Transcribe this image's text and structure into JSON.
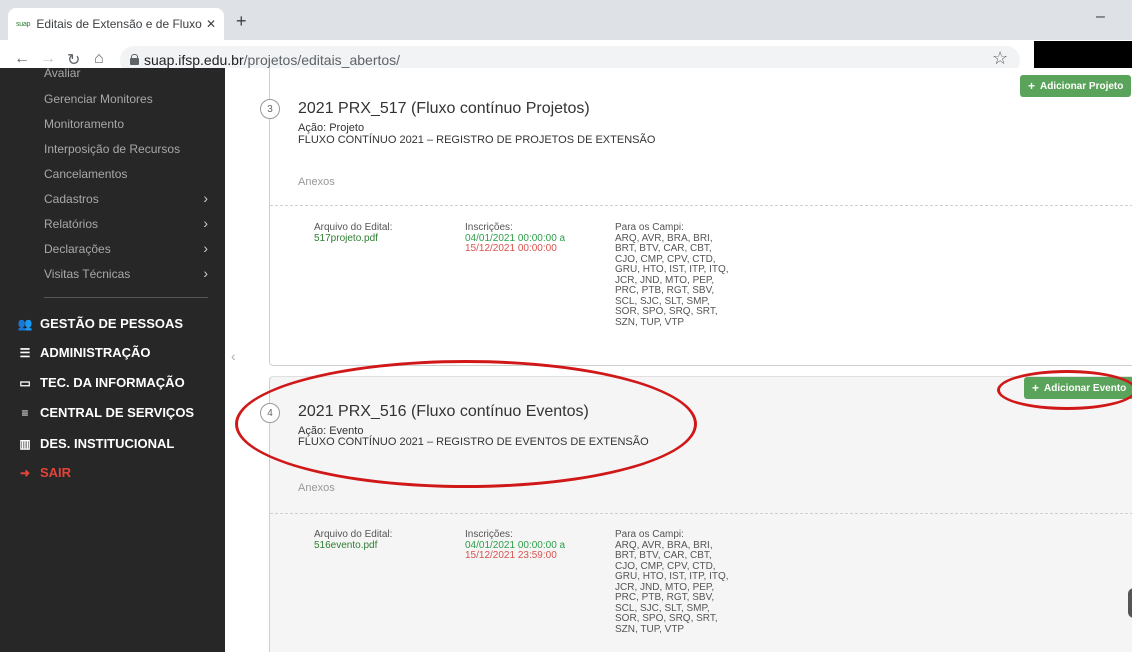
{
  "browser": {
    "tab_favicon": "suap",
    "tab_title": "Editais de Extensão e de Fluxo Co",
    "tab_close": "✕",
    "new_tab": "+",
    "minimize": "–",
    "url_host": "suap.ifsp.edu.br",
    "url_path": "/projetos/editais_abertos/"
  },
  "sidebar": {
    "items": [
      {
        "label": "Avaliar",
        "chevron": false
      },
      {
        "label": "Gerenciar Monitores",
        "chevron": false
      },
      {
        "label": "Monitoramento",
        "chevron": false
      },
      {
        "label": "Interposição de Recursos",
        "chevron": false
      },
      {
        "label": "Cancelamentos",
        "chevron": false
      },
      {
        "label": "Cadastros",
        "chevron": true
      },
      {
        "label": "Relatórios",
        "chevron": true
      },
      {
        "label": "Declarações",
        "chevron": true
      },
      {
        "label": "Visitas Técnicas",
        "chevron": true
      }
    ],
    "sections": [
      {
        "label": "GESTÃO DE PESSOAS",
        "icon": "people-icon"
      },
      {
        "label": "ADMINISTRAÇÃO",
        "icon": "list-icon"
      },
      {
        "label": "TEC. DA INFORMAÇÃO",
        "icon": "monitor-icon"
      },
      {
        "label": "CENTRAL DE SERVIÇOS",
        "icon": "menu-icon"
      },
      {
        "label": "DES. INSTITUCIONAL",
        "icon": "chart-icon"
      },
      {
        "label": "SAIR",
        "icon": "logout-icon"
      }
    ]
  },
  "cards": [
    {
      "step": "3",
      "title": "2021 PRX_517 (Fluxo contínuo Projetos)",
      "acao_label": "Ação:",
      "acao_value": "Projeto",
      "description": "FLUXO CONTÍNUO 2021 – REGISTRO DE PROJETOS DE EXTENSÃO",
      "anexos": "Anexos",
      "button": "Adicionar Projeto",
      "arquivo_label": "Arquivo do Edital:",
      "arquivo_file": "517projeto.pdf",
      "inscricoes_label": "Inscrições:",
      "inscricoes_start": "04/01/2021 00:00:00 a",
      "inscricoes_end": "15/12/2021 00:00:00",
      "campi_label": "Para os Campi:",
      "campi": [
        "ARQ, AVR, BRA, BRI,",
        "BRT, BTV, CAR, CBT,",
        "CJO, CMP, CPV, CTD,",
        "GRU, HTO, IST, ITP, ITQ,",
        "JCR, JND, MTO, PEP,",
        "PRC, PTB, RGT, SBV,",
        "SCL, SJC, SLT, SMP,",
        "SOR, SPO, SRQ, SRT,",
        "SZN, TUP, VTP"
      ]
    },
    {
      "step": "4",
      "title": "2021 PRX_516 (Fluxo contínuo Eventos)",
      "acao_label": "Ação:",
      "acao_value": "Evento",
      "description": "FLUXO CONTÍNUO 2021 – REGISTRO DE EVENTOS DE EXTENSÃO",
      "anexos": "Anexos",
      "button": "Adicionar Evento",
      "arquivo_label": "Arquivo do Edital:",
      "arquivo_file": "516evento.pdf",
      "inscricoes_label": "Inscrições:",
      "inscricoes_start": "04/01/2021 00:00:00 a",
      "inscricoes_end": "15/12/2021 23:59:00",
      "campi_label": "Para os Campi:",
      "campi": [
        "ARQ, AVR, BRA, BRI,",
        "BRT, BTV, CAR, CBT,",
        "CJO, CMP, CPV, CTD,",
        "GRU, HTO, IST, ITP, ITQ,",
        "JCR, JND, MTO, PEP,",
        "PRC, PTB, RGT, SBV,",
        "SCL, SJC, SLT, SMP,",
        "SOR, SPO, SRQ, SRT,",
        "SZN, TUP, VTP"
      ]
    }
  ],
  "colors": {
    "sidebar_bg": "#272727",
    "accent_green": "#5aa35a",
    "date_green": "#2e9e4a",
    "date_red": "#d9534f",
    "annotation_red": "#d01818"
  }
}
